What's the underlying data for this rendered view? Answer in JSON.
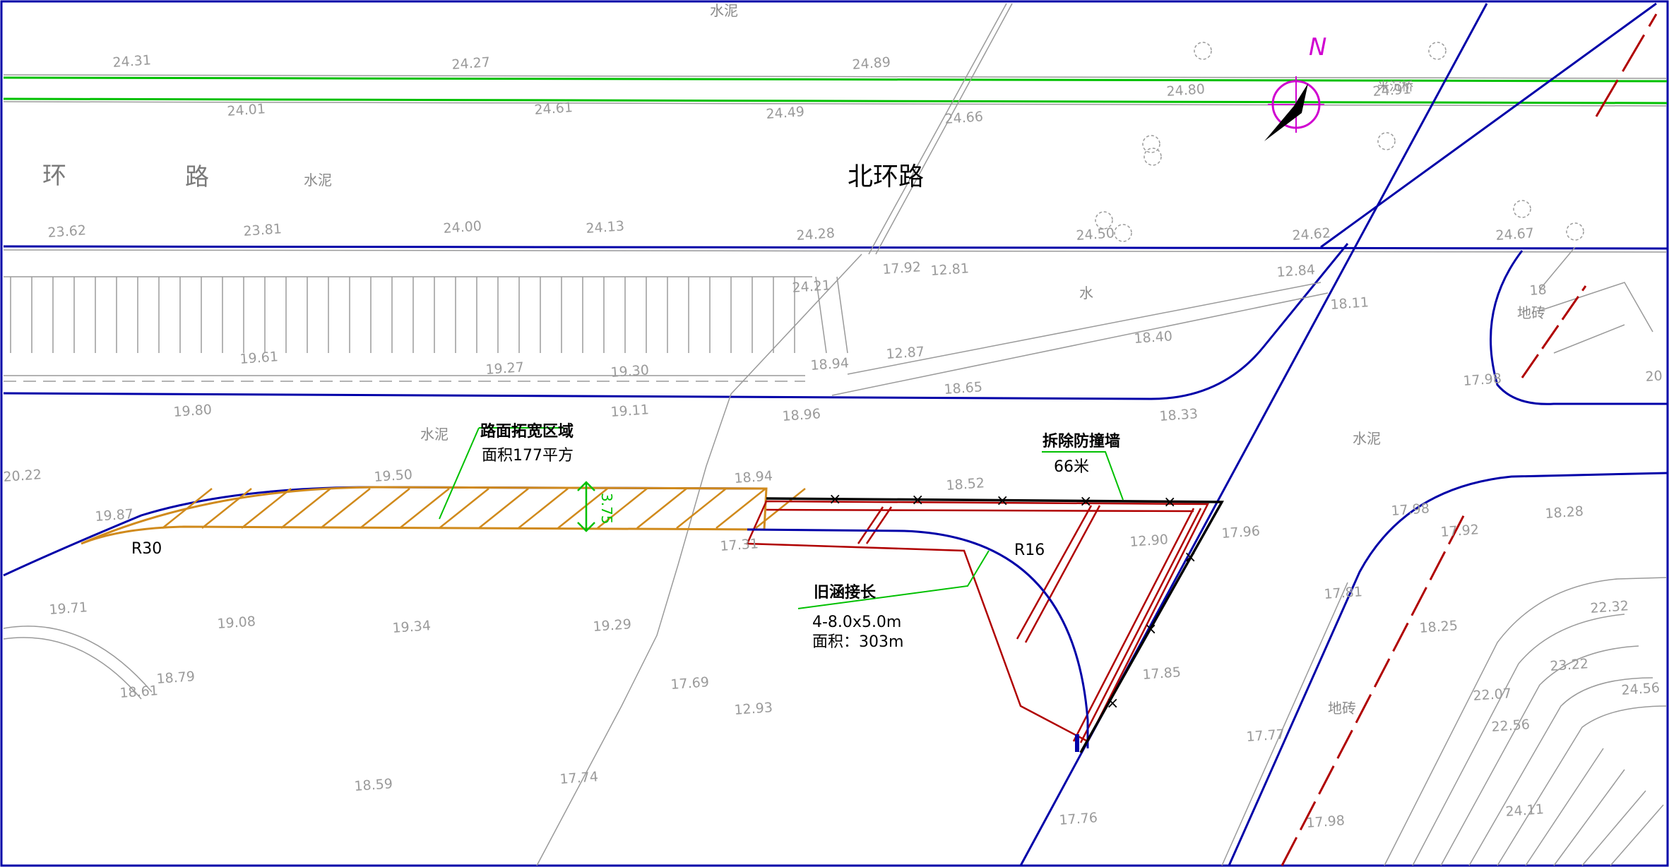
{
  "road_names": {
    "main": "北环路",
    "faded_1": "环",
    "faded_2": "路"
  },
  "surface_labels": [
    {
      "id": "sn1",
      "text": "水泥"
    },
    {
      "id": "sn2",
      "text": "水泥"
    },
    {
      "id": "sn3",
      "text": "水泥"
    },
    {
      "id": "sn4",
      "text": "水泥"
    },
    {
      "id": "sn5",
      "text": "水"
    },
    {
      "id": "dz1",
      "text": "地砖"
    },
    {
      "id": "dz2",
      "text": "地砖"
    },
    {
      "id": "br1",
      "text": "米沉桥"
    }
  ],
  "annotations": {
    "widen_title": "路面拓宽区域",
    "widen_area": "面积177平方",
    "wall_title": "拆除防撞墙",
    "wall_len": "66米",
    "culvert_title": "旧涵接长",
    "culvert_spec": "4-8.0x5.0m",
    "culvert_area": "面积：303m",
    "r30": "R30",
    "r16": "R16",
    "width_dim": "3.75",
    "north": "N"
  },
  "elevations": [
    {
      "id": "e01",
      "v": "24.31"
    },
    {
      "id": "e02",
      "v": "24.27"
    },
    {
      "id": "e03",
      "v": "24.89"
    },
    {
      "id": "e04",
      "v": "24.80"
    },
    {
      "id": "e05",
      "v": "24.91"
    },
    {
      "id": "e06",
      "v": "24.01"
    },
    {
      "id": "e07",
      "v": "24.61"
    },
    {
      "id": "e08",
      "v": "24.49"
    },
    {
      "id": "e09",
      "v": "24.66"
    },
    {
      "id": "e10",
      "v": "23.62"
    },
    {
      "id": "e11",
      "v": "23.81"
    },
    {
      "id": "e12",
      "v": "24.00"
    },
    {
      "id": "e13",
      "v": "24.13"
    },
    {
      "id": "e14",
      "v": "24.28"
    },
    {
      "id": "e15",
      "v": "24.50"
    },
    {
      "id": "e16",
      "v": "24.62"
    },
    {
      "id": "e17",
      "v": "24.67"
    },
    {
      "id": "e18",
      "v": "17.92"
    },
    {
      "id": "e19",
      "v": "12.81"
    },
    {
      "id": "e20",
      "v": "24.21"
    },
    {
      "id": "e21",
      "v": "12.84"
    },
    {
      "id": "e22",
      "v": "18.11"
    },
    {
      "id": "e23",
      "v": "19.61"
    },
    {
      "id": "e24",
      "v": "12.87"
    },
    {
      "id": "e25",
      "v": "18.40"
    },
    {
      "id": "e26",
      "v": "19.27"
    },
    {
      "id": "e27",
      "v": "19.30"
    },
    {
      "id": "e28",
      "v": "18.94"
    },
    {
      "id": "e29",
      "v": "18.65"
    },
    {
      "id": "e30",
      "v": "19.80"
    },
    {
      "id": "e31",
      "v": "19.11"
    },
    {
      "id": "e32",
      "v": "18.96"
    },
    {
      "id": "e33",
      "v": "18.33"
    },
    {
      "id": "e34",
      "v": "17.98"
    },
    {
      "id": "e35",
      "v": "20.22"
    },
    {
      "id": "e36",
      "v": "19.50"
    },
    {
      "id": "e37",
      "v": "18.94"
    },
    {
      "id": "e38",
      "v": "18.52"
    },
    {
      "id": "e39",
      "v": "19.87"
    },
    {
      "id": "e40",
      "v": "17.31"
    },
    {
      "id": "e41",
      "v": "12.90"
    },
    {
      "id": "e42",
      "v": "17.96"
    },
    {
      "id": "e43",
      "v": "17.98"
    },
    {
      "id": "e44",
      "v": "17.92"
    },
    {
      "id": "e45",
      "v": "18.28"
    },
    {
      "id": "e46",
      "v": "19.71"
    },
    {
      "id": "e47",
      "v": "19.08"
    },
    {
      "id": "e48",
      "v": "19.34"
    },
    {
      "id": "e49",
      "v": "19.29"
    },
    {
      "id": "e50",
      "v": "17.81"
    },
    {
      "id": "e51",
      "v": "22.32"
    },
    {
      "id": "e52",
      "v": "18.25"
    },
    {
      "id": "e53",
      "v": "18.79"
    },
    {
      "id": "e54",
      "v": "18.61"
    },
    {
      "id": "e55",
      "v": "17.69"
    },
    {
      "id": "e56",
      "v": "12.93"
    },
    {
      "id": "e57",
      "v": "17.85"
    },
    {
      "id": "e58",
      "v": "23.22"
    },
    {
      "id": "e59",
      "v": "22.07"
    },
    {
      "id": "e60",
      "v": "24.56"
    },
    {
      "id": "e61",
      "v": "22.56"
    },
    {
      "id": "e62",
      "v": "17.77"
    },
    {
      "id": "e63",
      "v": "17.74"
    },
    {
      "id": "e64",
      "v": "18.59"
    },
    {
      "id": "e65",
      "v": "17.76"
    },
    {
      "id": "e66",
      "v": "17.98"
    },
    {
      "id": "e67",
      "v": "24.11"
    },
    {
      "id": "e68",
      "v": "18"
    },
    {
      "id": "e69",
      "v": "20"
    }
  ],
  "colors": {
    "road_edge": "#0000a8",
    "green_line": "#00c000",
    "hatch": "#d08a1c",
    "culvert": "#b00000",
    "wall": "#000000",
    "compass": "#d000d0",
    "grey": "#9a9a9a",
    "leader": "#00c000"
  }
}
